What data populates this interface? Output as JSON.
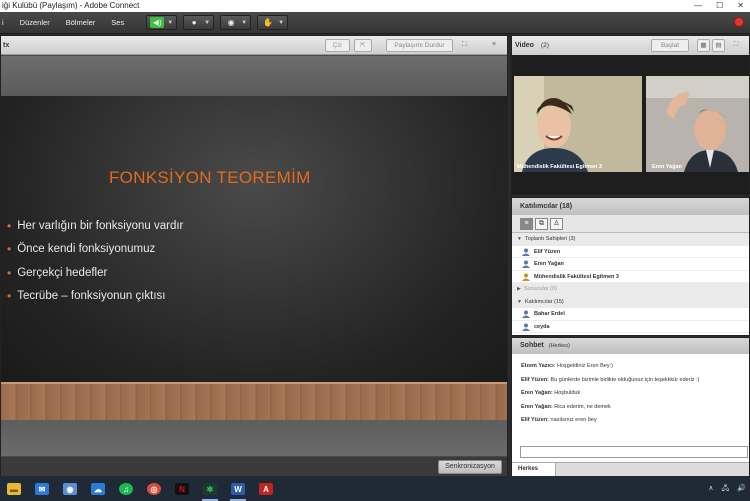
{
  "window": {
    "title": "iği Kulübü (Paylaşım) - Adobe Connect",
    "minimize": "—",
    "maximize": "☐",
    "close": "✕"
  },
  "menu": {
    "items": [
      "i",
      "Düzenler",
      "Bölmeler",
      "Ses"
    ],
    "buttons": [
      {
        "name": "speaker",
        "icon": "🔊",
        "color": "#3cbf3c"
      },
      {
        "name": "microphone",
        "icon": "🎤",
        "color": "#e0e0e0"
      },
      {
        "name": "webcam",
        "icon": "📷",
        "color": "#e0e0e0"
      },
      {
        "name": "raise-hand",
        "icon": "✋",
        "color": "#e0e0e0"
      }
    ]
  },
  "share_pod": {
    "title": "tx",
    "draw_label": "Çiz",
    "stop_label": "Paylaşımı Durdur",
    "fullscreen": "⛶",
    "menu": "≡",
    "sync_label": "Senkronizasyon",
    "slide": {
      "title": "FONKSİYON TEOREMİM",
      "bullets": [
        "Her varlığın bir fonksiyonu vardır",
        "Önce kendi fonksiyonumuz",
        "Gerçekçi hedefler",
        "Tecrübe – fonksiyonun çıktısı"
      ],
      "bullet_symbol": "•",
      "accent": "#e36a1e"
    }
  },
  "video_pod": {
    "title": "Video",
    "count": "(2)",
    "start_label": "Başlat",
    "tiles": [
      {
        "name": "Mühendislik Fakültesi Egitmen 3"
      },
      {
        "name": "Eren Yağan"
      }
    ]
  },
  "attendees_pod": {
    "title": "Katılımcılar (18)",
    "groups": [
      {
        "label": "Toplantı Sahipleri (3)",
        "members": [
          "Elif Yüzen",
          "Eren Yağan",
          "Mühendislik Fakültesi Egitmen 3"
        ]
      },
      {
        "label": "Sunucular (0)",
        "members": []
      },
      {
        "label": "Katılımcılar (15)",
        "members": [
          "Bahar Erdel",
          "ceyda"
        ]
      }
    ]
  },
  "chat_pod": {
    "title": "Sohbet",
    "scope": "(Herkes)",
    "messages": [
      {
        "sender": "Elzem Yazıcı:",
        "text": "Hoşgeldiniz Eren Bey:)"
      },
      {
        "sender": "Elif Yüzen:",
        "text": "Bu günlerde bizimle birlikte olduğunuz için teşekkkür ederiz :)"
      },
      {
        "sender": "Eren Yağan:",
        "text": "Hoşbulduk"
      },
      {
        "sender": "Eren Yağan:",
        "text": "Rica ederim, ne demek"
      },
      {
        "sender": "Elif Yüzen:",
        "text": "nasılsınız eren bey"
      }
    ],
    "tab_label": "Herkes"
  },
  "taskbar": {
    "apps": [
      {
        "name": "file-explorer",
        "glyph": "▬",
        "color": "#e8b830"
      },
      {
        "name": "mail",
        "glyph": "✉",
        "color": "#2a7bd4"
      },
      {
        "name": "photos",
        "glyph": "◉",
        "color": "#5a8fd8"
      },
      {
        "name": "onedrive",
        "glyph": "☁",
        "color": "#2a7bd4"
      },
      {
        "name": "spotify",
        "glyph": "♫",
        "color": "#1db954"
      },
      {
        "name": "chrome",
        "glyph": "◎",
        "color": "#d94b3a"
      },
      {
        "name": "netflix",
        "glyph": "N",
        "color": "#c8101a"
      },
      {
        "name": "adobe-connect",
        "glyph": "✲",
        "color": "#2d9a5a"
      },
      {
        "name": "word",
        "glyph": "W",
        "color": "#2b5cab"
      },
      {
        "name": "acrobat",
        "glyph": "A",
        "color": "#c0241c"
      }
    ],
    "tray": [
      "∧",
      "🖧",
      "🔊"
    ]
  }
}
